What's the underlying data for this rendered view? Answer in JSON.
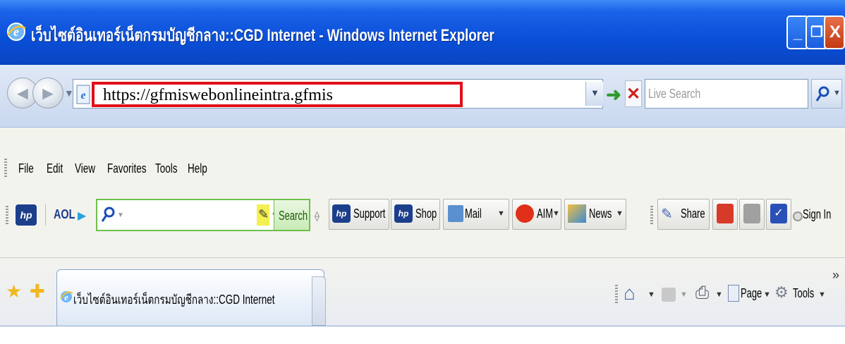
{
  "window": {
    "title": "เว็บไซต์อินเทอร์เน็ตกรมบัญชีกลาง::CGD Internet - Windows Internet Explorer",
    "minimize_label": "_",
    "maximize_label": "❐",
    "close_label": "X"
  },
  "address_bar": {
    "url": "https://gfmiswebonlineintra.gfmis",
    "search_placeholder": "Live Search"
  },
  "menu": {
    "items": [
      "File",
      "Edit",
      "View",
      "Favorites",
      "Tools",
      "Help"
    ]
  },
  "aol_toolbar": {
    "aol_label": "AOL",
    "search_button": "Search",
    "buttons": {
      "support": "Support",
      "shop": "Shop",
      "mail": "Mail",
      "aim": "AIM",
      "news": "News",
      "share": "Share",
      "sign_in": "Sign In"
    }
  },
  "tabs": {
    "active_tab": "เว็บไซต์อินเทอร์เน็ตกรมบัญชีกลาง::CGD Internet"
  },
  "command_bar": {
    "page": "Page",
    "tools": "Tools",
    "chevron": "»"
  },
  "colors": {
    "titlebar": "#0a4fd8",
    "url_highlight": "#e0101a",
    "search_green": "#6fc04a"
  }
}
